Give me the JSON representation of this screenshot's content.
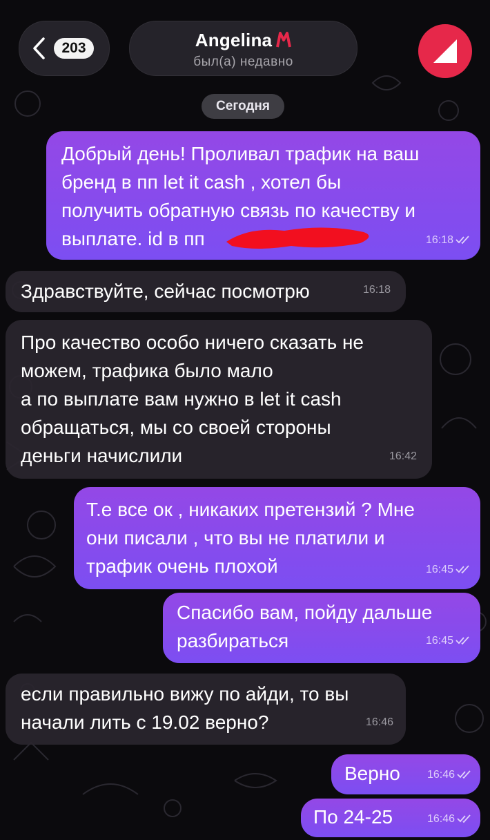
{
  "header": {
    "unread_count": "203",
    "contact_name": "Angelina",
    "status": "был(а) недавно"
  },
  "date_label": "Сегодня",
  "messages": [
    {
      "dir": "out",
      "text": "Добрый день! Проливал трафик на ваш\nбренд в пп let it cash , хотел бы\nполучить обратную связь по качеству и\nвыплате. id в пп",
      "time": "16:18",
      "read": true
    },
    {
      "dir": "in",
      "text": "Здравствуйте, сейчас посмотрю",
      "time": "16:18"
    },
    {
      "dir": "in",
      "text": "Про качество особо ничего сказать не\nможем, трафика было мало\nа по выплате вам нужно в let it cash\nобращаться, мы со своей стороны\nденьги начислили",
      "time": "16:42"
    },
    {
      "dir": "out",
      "text": "Т.е все ок , никаких претензий ? Мне\nони писали , что вы не платили и\nтрафик очень плохой",
      "time": "16:45",
      "read": true
    },
    {
      "dir": "out",
      "text": "Спасибо вам, пойду дальше\nразбираться",
      "time": "16:45",
      "read": true
    },
    {
      "dir": "in",
      "text": "если правильно вижу по айди, то вы\nначали лить с 19.02 верно?",
      "time": "16:46"
    },
    {
      "dir": "out",
      "text": "Верно",
      "time": "16:46",
      "read": true
    },
    {
      "dir": "out",
      "text": "По 24-25",
      "time": "16:46",
      "read": true
    }
  ],
  "colors": {
    "outgoing_bubble": "#8a4bec",
    "incoming_bubble": "#2a262e",
    "background": "#0b0a0d",
    "avatar": "#e6284a"
  }
}
